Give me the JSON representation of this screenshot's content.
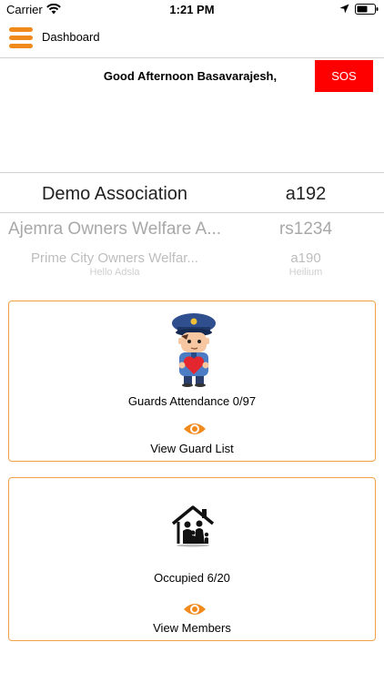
{
  "status_bar": {
    "carrier": "Carrier",
    "time": "1:21 PM"
  },
  "nav": {
    "title": "Dashboard"
  },
  "greeting": "Good Afternoon Basavarajesh,",
  "sos_label": "SOS",
  "associations": [
    {
      "name": "Demo Association",
      "code": "a192"
    },
    {
      "name": "Ajemra Owners Welfare A...",
      "code": "rs1234"
    },
    {
      "name": "Prime City Owners Welfar...",
      "code": "a190"
    },
    {
      "name": "Hello Adsla",
      "code": "Heilium"
    }
  ],
  "guard_card": {
    "title": "Guards Attendance 0/97",
    "link": "View Guard List"
  },
  "members_card": {
    "title": "Occupied 6/20",
    "link": "View Members"
  },
  "colors": {
    "accent": "#f08a1c",
    "card_border": "#f0a24a",
    "sos": "#ff0000"
  }
}
